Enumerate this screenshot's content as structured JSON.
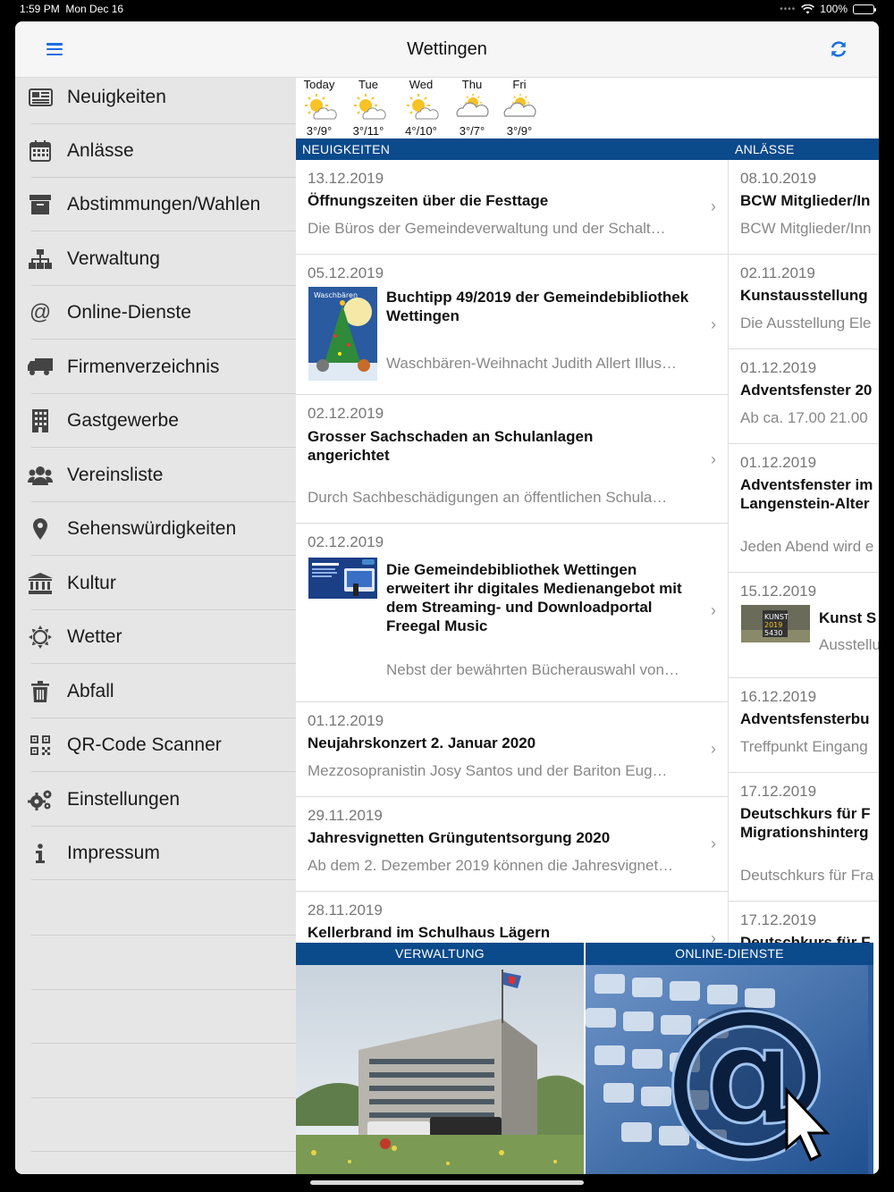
{
  "status": {
    "time": "1:59 PM",
    "date": "Mon Dec 16",
    "battery": "100%"
  },
  "navbar": {
    "title": "Wettingen"
  },
  "sidebar": {
    "items": [
      {
        "label": "Neuigkeiten",
        "icon": "newspaper-icon"
      },
      {
        "label": "Anlässe",
        "icon": "calendar-icon"
      },
      {
        "label": "Abstimmungen/Wahlen",
        "icon": "archive-box-icon"
      },
      {
        "label": "Verwaltung",
        "icon": "sitemap-icon"
      },
      {
        "label": "Online-Dienste",
        "icon": "at-icon"
      },
      {
        "label": "Firmenverzeichnis",
        "icon": "truck-icon"
      },
      {
        "label": "Gastgewerbe",
        "icon": "building-icon"
      },
      {
        "label": "Vereinsliste",
        "icon": "users-icon"
      },
      {
        "label": "Sehenswürdigkeiten",
        "icon": "map-pin-icon"
      },
      {
        "label": "Kultur",
        "icon": "museum-icon"
      },
      {
        "label": "Wetter",
        "icon": "sun-icon"
      },
      {
        "label": "Abfall",
        "icon": "trash-icon"
      },
      {
        "label": "QR-Code Scanner",
        "icon": "qr-code-icon"
      },
      {
        "label": "Einstellungen",
        "icon": "gears-icon"
      },
      {
        "label": "Impressum",
        "icon": "info-icon"
      }
    ]
  },
  "weather": [
    {
      "day": "Today",
      "temp": "3°/9°",
      "icon": "sun-cloud-icon"
    },
    {
      "day": "Tue",
      "temp": "3°/11°",
      "icon": "sun-cloud-icon"
    },
    {
      "day": "Wed",
      "temp": "4°/10°",
      "icon": "sun-cloud-icon"
    },
    {
      "day": "Thu",
      "temp": "3°/7°",
      "icon": "cloud-sun-icon"
    },
    {
      "day": "Fri",
      "temp": "3°/9°",
      "icon": "cloud-sun-icon"
    }
  ],
  "news": {
    "header": "NEUIGKEITEN",
    "items": [
      {
        "date": "13.12.2019",
        "title": "Öffnungszeiten über die Festtage",
        "desc": "Die Büros der Gemeindeverwaltung und der Schalt…"
      },
      {
        "date": "05.12.2019",
        "title": "Buchtipp 49/2019 der Gemeindebibliothek Wettingen",
        "desc": "Waschbären-Weihnacht  Judith Allert Illus…"
      },
      {
        "date": "02.12.2019",
        "title": "Grosser Sachschaden an Schulanlagen angerichtet",
        "desc": "Durch Sachbeschädigungen an öffentlichen Schula…"
      },
      {
        "date": "02.12.2019",
        "title": "Die Gemeindebibliothek Wettingen erweitert ihr digitales Medienangebot mit dem Streaming- und Downloadportal Freegal Music",
        "desc": "Nebst der bewährten Bücherauswahl von…"
      },
      {
        "date": "01.12.2019",
        "title": "Neujahrskonzert 2. Januar 2020",
        "desc": "Mezzosopranistin Josy Santos und der Bariton Eug…"
      },
      {
        "date": "29.11.2019",
        "title": "Jahresvignetten Grüngutentsorgung 2020",
        "desc": "Ab dem 2. Dezember 2019 können die Jahresvignet…"
      },
      {
        "date": "28.11.2019",
        "title": "Kellerbrand im Schulhaus Lägern",
        "desc": ""
      }
    ]
  },
  "events": {
    "header": "ANLÄSSE",
    "items": [
      {
        "date": "08.10.2019",
        "title": "BCW Mitglieder/In",
        "desc": "BCW Mitglieder/Inn"
      },
      {
        "date": "02.11.2019",
        "title": "Kunstausstellung",
        "desc": "Die Ausstellung Ele"
      },
      {
        "date": "01.12.2019",
        "title": "Adventsfenster 20",
        "desc": "Ab ca. 17.00  21.00"
      },
      {
        "date": "01.12.2019",
        "title": "Adventsfenster im",
        "title2": "Langenstein-Alter",
        "desc": "Jeden Abend wird e"
      },
      {
        "date": "15.12.2019",
        "title": "Kunst S",
        "desc": "Ausstellu"
      },
      {
        "date": "16.12.2019",
        "title": "Adventsfensterbu",
        "desc": "Treffpunkt Eingang"
      },
      {
        "date": "17.12.2019",
        "title": "Deutschkurs für F",
        "title2": "Migrationshinterg",
        "desc": "Deutschkurs für Fra"
      },
      {
        "date": "17.12.2019",
        "title": "Deutschkurs für F",
        "desc": ""
      }
    ]
  },
  "tiles": [
    {
      "label": "VERWALTUNG"
    },
    {
      "label": "ONLINE-DIENSTE"
    }
  ],
  "colors": {
    "accent": "#1c6fe0",
    "header_blue": "#0b4a8b",
    "sidebar_bg": "#e6e6e6"
  }
}
